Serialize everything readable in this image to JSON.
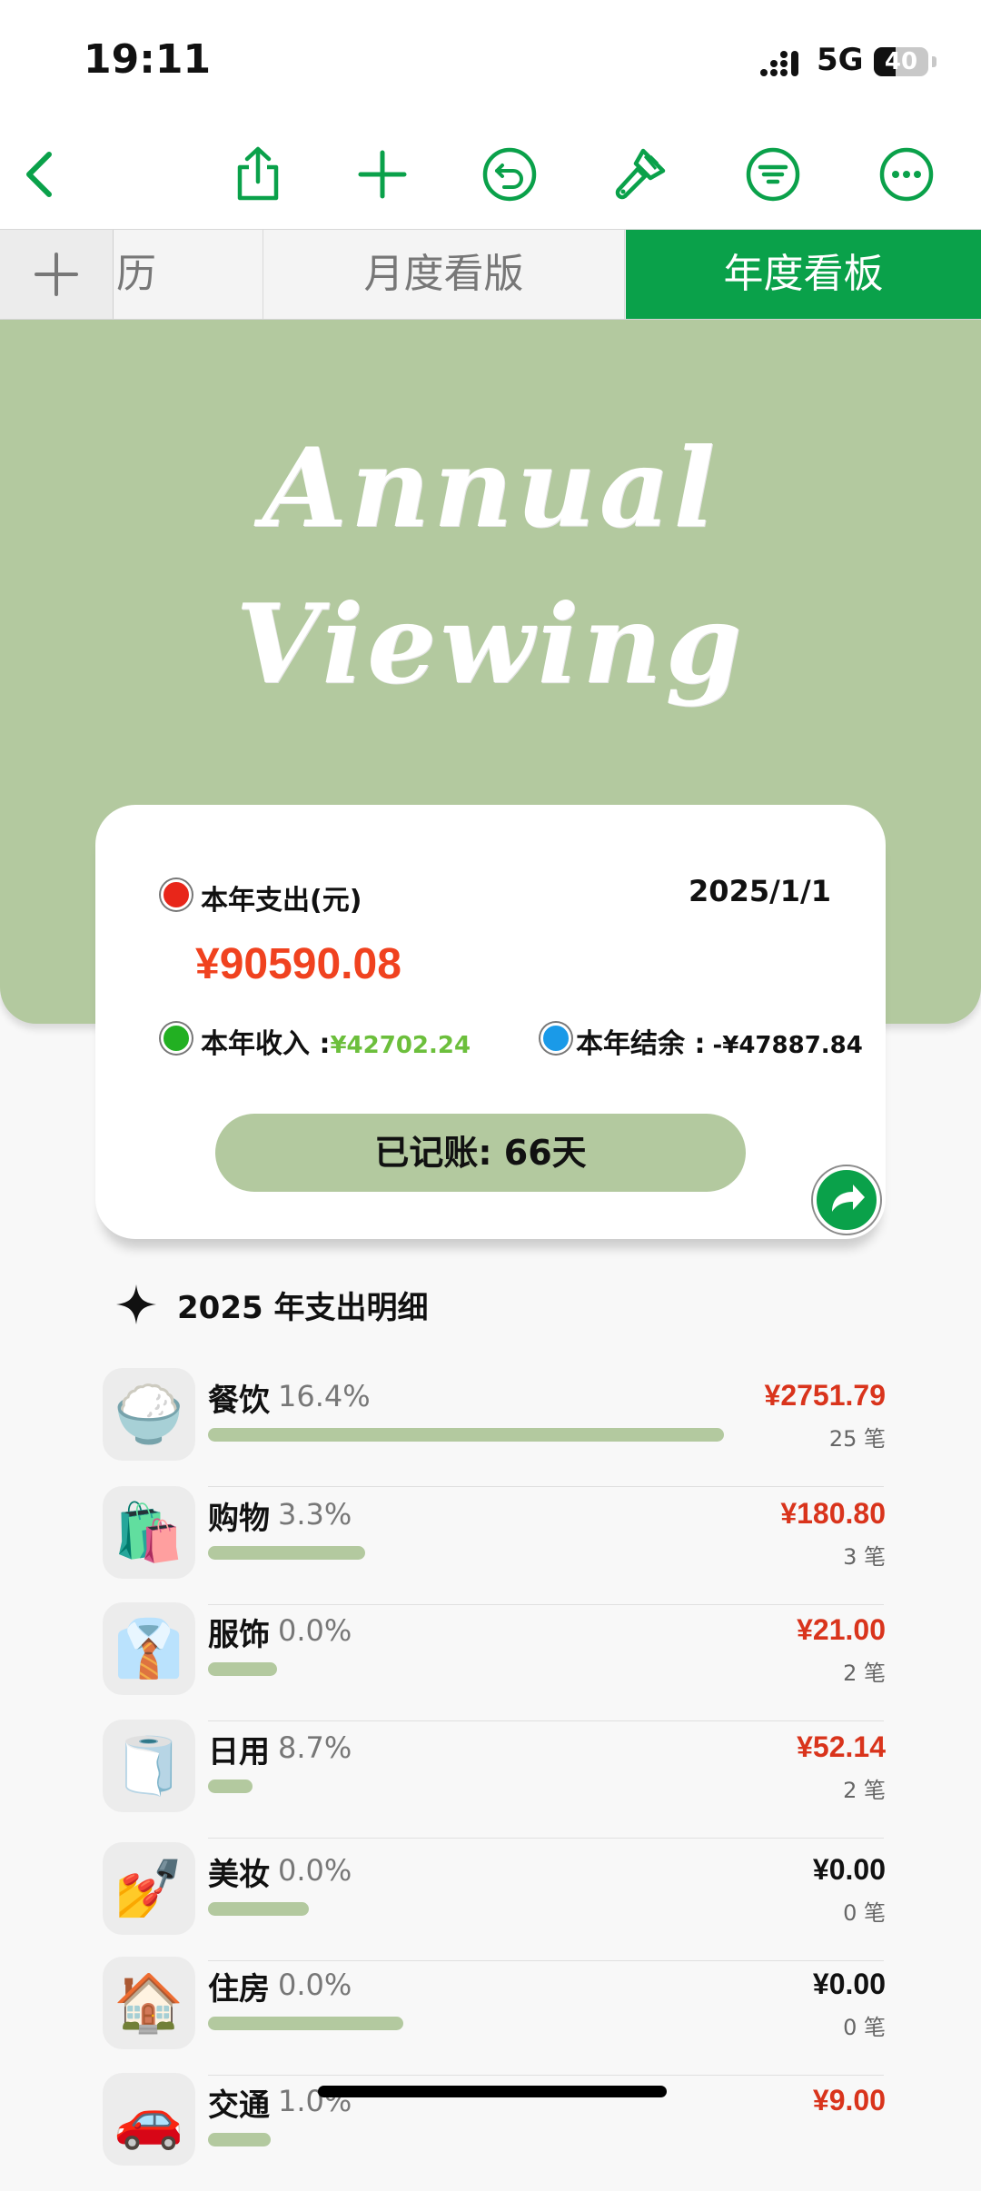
{
  "status_bar": {
    "time": "19:11",
    "network": "5G",
    "battery": "40",
    "battery_level": 0.4
  },
  "toolbar": {
    "icons": [
      "back-icon",
      "share-icon",
      "plus-icon",
      "undo-icon",
      "paintbrush-icon",
      "filter-icon",
      "more-icon"
    ],
    "accent_color": "#0aa14a"
  },
  "tabs": {
    "add_icon": "plus-icon",
    "items": [
      {
        "label": "日历",
        "visible_label": "历",
        "selected": false
      },
      {
        "label": "月度看版",
        "selected": false
      },
      {
        "label": "年度看板",
        "selected": true
      }
    ]
  },
  "hero": {
    "title_line1": "Annual",
    "title_line2": "Viewing",
    "background_color": "#b3c99f"
  },
  "summary": {
    "expense_label": "本年支出(元)",
    "expense_amount": "¥90590.08",
    "date": "2025/1/1",
    "income_label": "本年收入 :",
    "income_value": "¥42702.24",
    "balance_label": "本年结余 :",
    "balance_value": "-¥47887.84",
    "days_label": "已记账: 66天",
    "colors": {
      "expense_dot": "#e8261a",
      "income_dot": "#22b022",
      "balance_dot": "#1a9ae8",
      "expense_text": "#f0421f",
      "income_text": "#6cbf3c"
    }
  },
  "section": {
    "icon": "sparkle-icon",
    "title": "2025 年支出明细"
  },
  "categories": [
    {
      "name": "餐饮",
      "percent": "16.4%",
      "amount": "¥2751.79",
      "count": "25 笔",
      "icon": "rice-bowl-icon",
      "emoji": "🍚",
      "bar_fraction": 0.82
    },
    {
      "name": "购物",
      "percent": "3.3%",
      "amount": "¥180.80",
      "count": "3 笔",
      "icon": "shopping-bags-icon",
      "emoji": "🛍️",
      "bar_fraction": 0.25
    },
    {
      "name": "服饰",
      "percent": "0.0%",
      "amount": "¥21.00",
      "count": "2 笔",
      "icon": "shirt-tie-icon",
      "emoji": "👔",
      "bar_fraction": 0.11
    },
    {
      "name": "日用",
      "percent": "8.7%",
      "amount": "¥52.14",
      "count": "2 笔",
      "icon": "toilet-paper-icon",
      "emoji": "🧻",
      "bar_fraction": 0.07
    },
    {
      "name": "美妆",
      "percent": "0.0%",
      "amount": "¥0.00",
      "count": "0 笔",
      "icon": "nail-polish-icon",
      "emoji": "💅",
      "bar_fraction": 0.16
    },
    {
      "name": "住房",
      "percent": "0.0%",
      "amount": "¥0.00",
      "count": "0 笔",
      "icon": "house-icon",
      "emoji": "🏠",
      "bar_fraction": 0.31
    },
    {
      "name": "交通",
      "percent": "1.0%",
      "amount": "¥9.00",
      "count": "",
      "icon": "car-icon",
      "emoji": "🚗",
      "bar_fraction": 0.1
    }
  ]
}
